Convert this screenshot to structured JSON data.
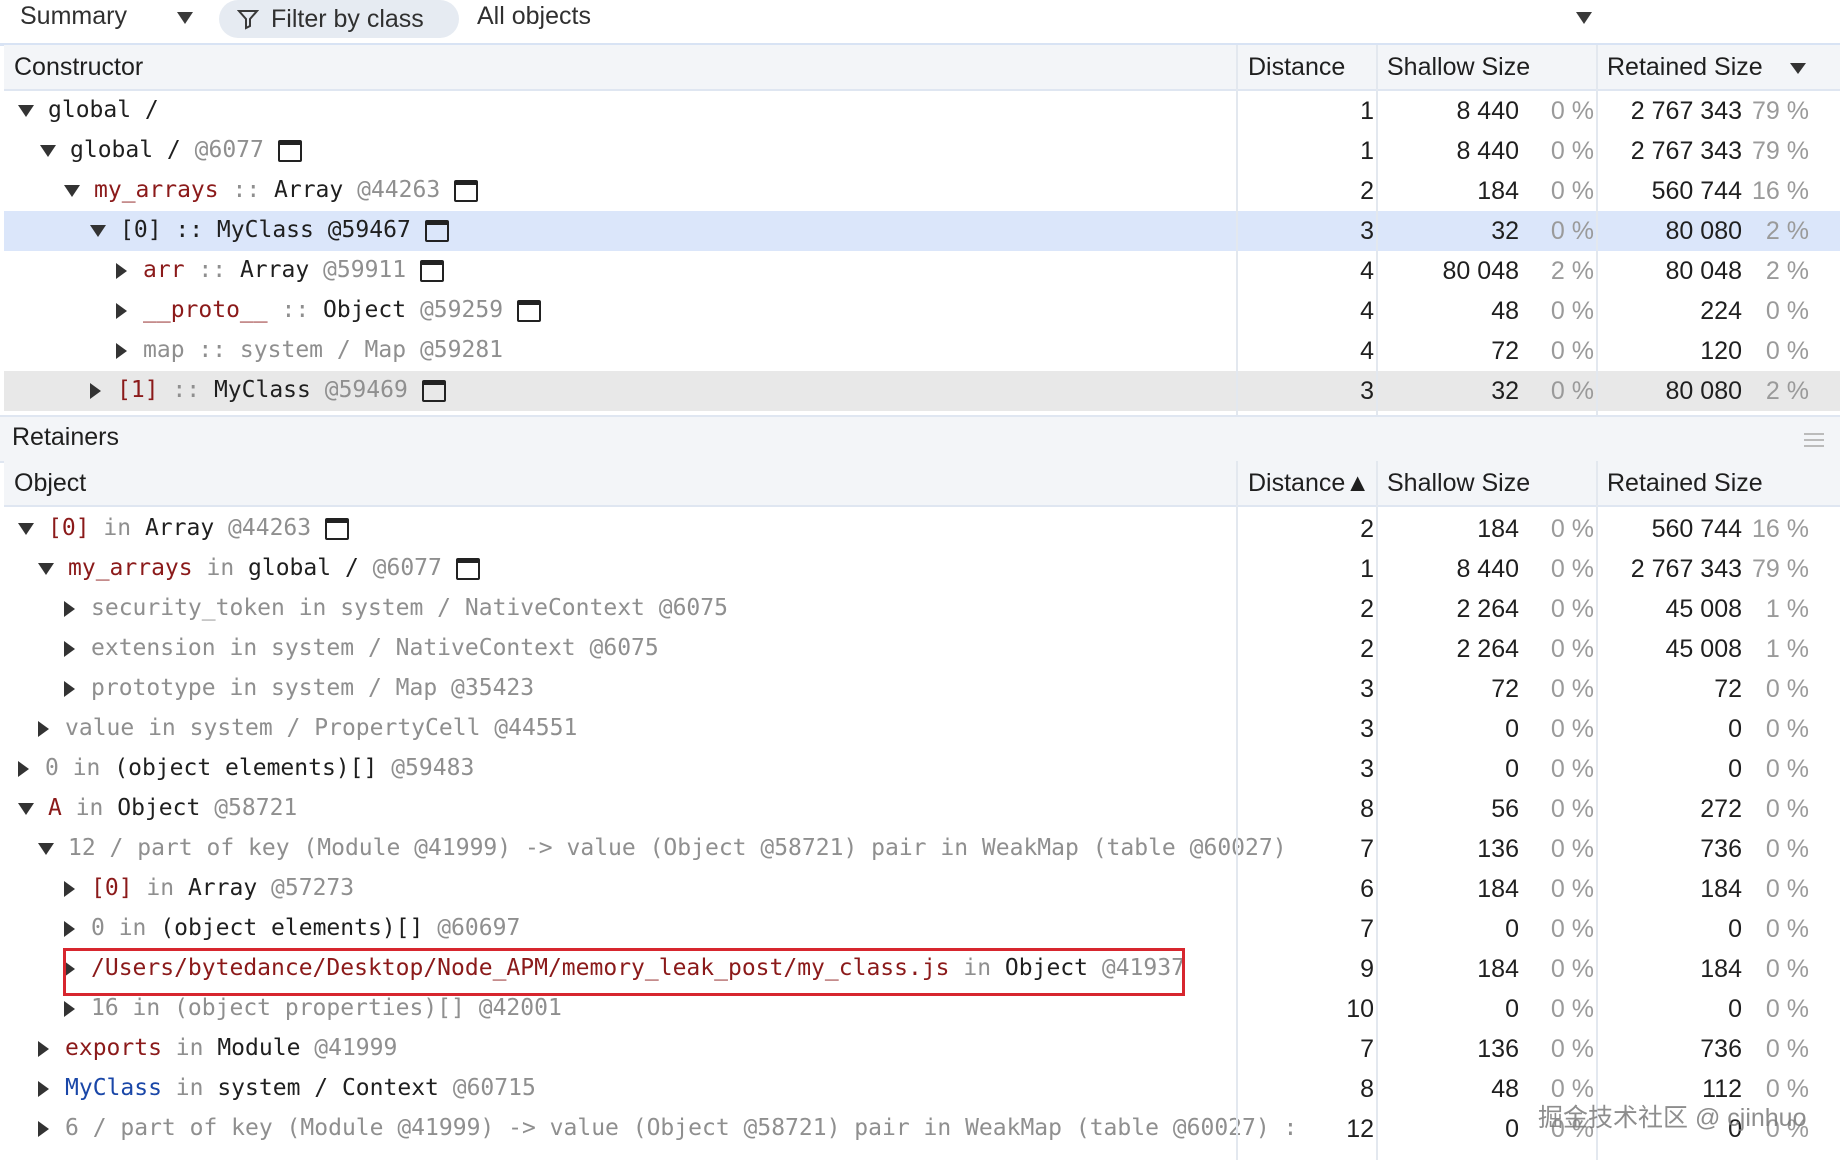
{
  "toolbar": {
    "view_select": "Summary",
    "filter_label": "Filter by class",
    "objects_select": "All objects"
  },
  "top_table": {
    "headers": {
      "constructor": "Constructor",
      "distance": "Distance",
      "shallow": "Shallow Size",
      "retained": "Retained Size"
    },
    "rows": [
      {
        "parts": [
          [
            "dark",
            "global /"
          ]
        ],
        "dist": "1",
        "shallow": "8 440",
        "sp": "0 %",
        "retained": "2 767 343",
        "rp": "79 %"
      },
      {
        "parts": [
          [
            "dark",
            "global / "
          ],
          [
            "gray",
            " @6077"
          ]
        ],
        "dist": "1",
        "shallow": "8 440",
        "sp": "0 %",
        "retained": "2 767 343",
        "rp": "79 %"
      },
      {
        "parts": [
          [
            "kw",
            "my_arrays"
          ],
          [
            "gray",
            " :: "
          ],
          [
            "dark",
            "Array"
          ],
          [
            "gray",
            " @44263"
          ]
        ],
        "dist": "2",
        "shallow": "184",
        "sp": "0 %",
        "retained": "560 744",
        "rp": "16 %"
      },
      {
        "parts": [
          [
            "dark",
            "[0] :: MyClass @59467"
          ]
        ],
        "dist": "3",
        "shallow": "32",
        "sp": "0 %",
        "retained": "80 080",
        "rp": "2 %"
      },
      {
        "parts": [
          [
            "kw",
            "arr"
          ],
          [
            "gray",
            " :: "
          ],
          [
            "dark",
            "Array"
          ],
          [
            "gray",
            " @59911"
          ]
        ],
        "dist": "4",
        "shallow": "80 048",
        "sp": "2 %",
        "retained": "80 048",
        "rp": "2 %"
      },
      {
        "parts": [
          [
            "kw",
            "__proto__"
          ],
          [
            "gray",
            " :: "
          ],
          [
            "dark",
            "Object"
          ],
          [
            "gray",
            " @59259"
          ]
        ],
        "dist": "4",
        "shallow": "48",
        "sp": "0 %",
        "retained": "224",
        "rp": "0 %"
      },
      {
        "parts": [
          [
            "gray",
            "map :: system / Map @59281"
          ]
        ],
        "dist": "4",
        "shallow": "72",
        "sp": "0 %",
        "retained": "120",
        "rp": "0 %"
      },
      {
        "parts": [
          [
            "kw",
            "[1]"
          ],
          [
            "gray",
            " :: "
          ],
          [
            "dark",
            "MyClass"
          ],
          [
            "gray",
            " @59469"
          ]
        ],
        "dist": "3",
        "shallow": "32",
        "sp": "0 %",
        "retained": "80 080",
        "rp": "2 %"
      }
    ]
  },
  "retainers": {
    "title": "Retainers",
    "headers": {
      "object": "Object",
      "distance": "Distance▲",
      "shallow": "Shallow Size",
      "retained": "Retained Size"
    },
    "rows": [
      {
        "parts": [
          [
            "kw",
            "[0]"
          ],
          [
            "gray",
            " in "
          ],
          [
            "dark",
            "Array"
          ],
          [
            "gray",
            " @44263"
          ]
        ],
        "dist": "2",
        "shallow": "184",
        "sp": "0 %",
        "retained": "560 744",
        "rp": "16 %"
      },
      {
        "parts": [
          [
            "kw",
            "my_arrays"
          ],
          [
            "gray",
            " in "
          ],
          [
            "dark",
            "global / "
          ],
          [
            "gray",
            " @6077"
          ]
        ],
        "dist": "1",
        "shallow": "8 440",
        "sp": "0 %",
        "retained": "2 767 343",
        "rp": "79 %"
      },
      {
        "parts": [
          [
            "gray",
            "security_token in system / NativeContext "
          ],
          [
            "gray",
            "@6075"
          ]
        ],
        "dist": "2",
        "shallow": "2 264",
        "sp": "0 %",
        "retained": "45 008",
        "rp": "1 %"
      },
      {
        "parts": [
          [
            "gray",
            "extension in system / NativeContext "
          ],
          [
            "gray",
            "@6075"
          ]
        ],
        "dist": "2",
        "shallow": "2 264",
        "sp": "0 %",
        "retained": "45 008",
        "rp": "1 %"
      },
      {
        "parts": [
          [
            "gray",
            "prototype in system / Map "
          ],
          [
            "gray",
            "@35423"
          ]
        ],
        "dist": "3",
        "shallow": "72",
        "sp": "0 %",
        "retained": "72",
        "rp": "0 %"
      },
      {
        "parts": [
          [
            "gray",
            "value in system / PropertyCell "
          ],
          [
            "gray",
            "@44551"
          ]
        ],
        "dist": "3",
        "shallow": "0",
        "sp": "0 %",
        "retained": "0",
        "rp": "0 %"
      },
      {
        "parts": [
          [
            "gray",
            "0"
          ],
          [
            "gray",
            " in "
          ],
          [
            "dark",
            "(object elements)[]"
          ],
          [
            "gray",
            " @59483"
          ]
        ],
        "dist": "3",
        "shallow": "0",
        "sp": "0 %",
        "retained": "0",
        "rp": "0 %"
      },
      {
        "parts": [
          [
            "kw",
            "A"
          ],
          [
            "gray",
            " in "
          ],
          [
            "dark",
            "Object"
          ],
          [
            "gray",
            " @58721"
          ]
        ],
        "dist": "8",
        "shallow": "56",
        "sp": "0 %",
        "retained": "272",
        "rp": "0 %"
      },
      {
        "parts": [
          [
            "gray",
            "12 / part of key (Module @41999) -> value (Object @58721) pair in WeakMap (table @60027)"
          ]
        ],
        "dist": "7",
        "shallow": "136",
        "sp": "0 %",
        "retained": "736",
        "rp": "0 %"
      },
      {
        "parts": [
          [
            "kw",
            "[0]"
          ],
          [
            "gray",
            " in "
          ],
          [
            "dark",
            "Array"
          ],
          [
            "gray",
            " @57273"
          ]
        ],
        "dist": "6",
        "shallow": "184",
        "sp": "0 %",
        "retained": "184",
        "rp": "0 %"
      },
      {
        "parts": [
          [
            "gray",
            "0"
          ],
          [
            "gray",
            " in "
          ],
          [
            "dark",
            "(object elements)[]"
          ],
          [
            "gray",
            " @60697"
          ]
        ],
        "dist": "7",
        "shallow": "0",
        "sp": "0 %",
        "retained": "0",
        "rp": "0 %"
      },
      {
        "parts": [
          [
            "kw",
            "/Users/bytedance/Desktop/Node_APM/memory_leak_post/my_class.js"
          ],
          [
            "gray",
            " in "
          ],
          [
            "dark",
            "Object"
          ],
          [
            "gray",
            " @41937"
          ]
        ],
        "dist": "9",
        "shallow": "184",
        "sp": "0 %",
        "retained": "184",
        "rp": "0 %"
      },
      {
        "parts": [
          [
            "gray",
            "16 in (object properties)[] @42001"
          ]
        ],
        "dist": "10",
        "shallow": "0",
        "sp": "0 %",
        "retained": "0",
        "rp": "0 %"
      },
      {
        "parts": [
          [
            "kw",
            "exports"
          ],
          [
            "gray",
            " in "
          ],
          [
            "dark",
            "Module"
          ],
          [
            "gray",
            " @41999"
          ]
        ],
        "dist": "7",
        "shallow": "136",
        "sp": "0 %",
        "retained": "736",
        "rp": "0 %"
      },
      {
        "parts": [
          [
            "blue",
            "MyClass"
          ],
          [
            "gray",
            " in "
          ],
          [
            "dark",
            "system / Context"
          ],
          [
            "gray",
            " @60715"
          ]
        ],
        "dist": "8",
        "shallow": "48",
        "sp": "0 %",
        "retained": "112",
        "rp": "0 %"
      },
      {
        "parts": [
          [
            "gray",
            "6 / part of key (Module @41999) -> value (Object @58721) pair in WeakMap (table @60027) :"
          ]
        ],
        "dist": "12",
        "shallow": "0",
        "sp": "0 %",
        "retained": "0",
        "rp": "0 %"
      }
    ]
  },
  "watermark": "掘金技术社区 @ cjinhuo"
}
